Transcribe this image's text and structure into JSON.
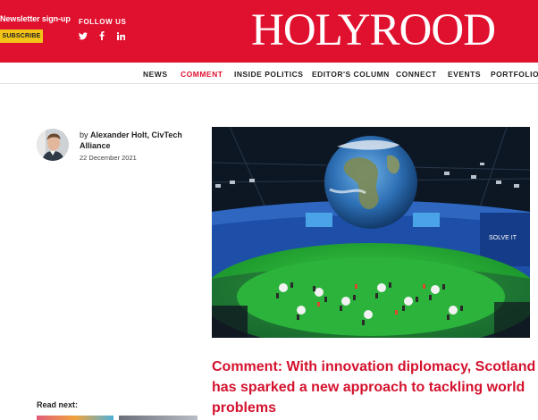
{
  "header": {
    "newsletter_label": "Newsletter sign-up",
    "subscribe_label": "SUBSCRIBE",
    "follow_label": "FOLLOW US",
    "social_icons": [
      "twitter-icon",
      "facebook-icon",
      "linkedin-icon"
    ],
    "logo_text": "HOLYROOD",
    "brand_color": "#e0102f",
    "subscribe_color": "#f2c417"
  },
  "nav": {
    "items": [
      {
        "label": "NEWS",
        "active": false
      },
      {
        "label": "COMMENT",
        "active": true
      },
      {
        "label": "INSIDE POLITICS",
        "active": false
      },
      {
        "label": "EDITOR'S COLUMN",
        "active": false
      },
      {
        "label": "CONNECT",
        "active": false
      },
      {
        "label": "EVENTS",
        "active": false
      },
      {
        "label": "PORTFOLIOS",
        "active": false
      }
    ]
  },
  "article": {
    "by_prefix": "by",
    "author": "Alexander Holt, CivTech Alliance",
    "date": "22 December 2021",
    "title": "Comment: With innovation diplomacy, Scotland has sparked a new approach to tackling world problems"
  },
  "sidebar": {
    "read_next_label": "Read next:"
  }
}
